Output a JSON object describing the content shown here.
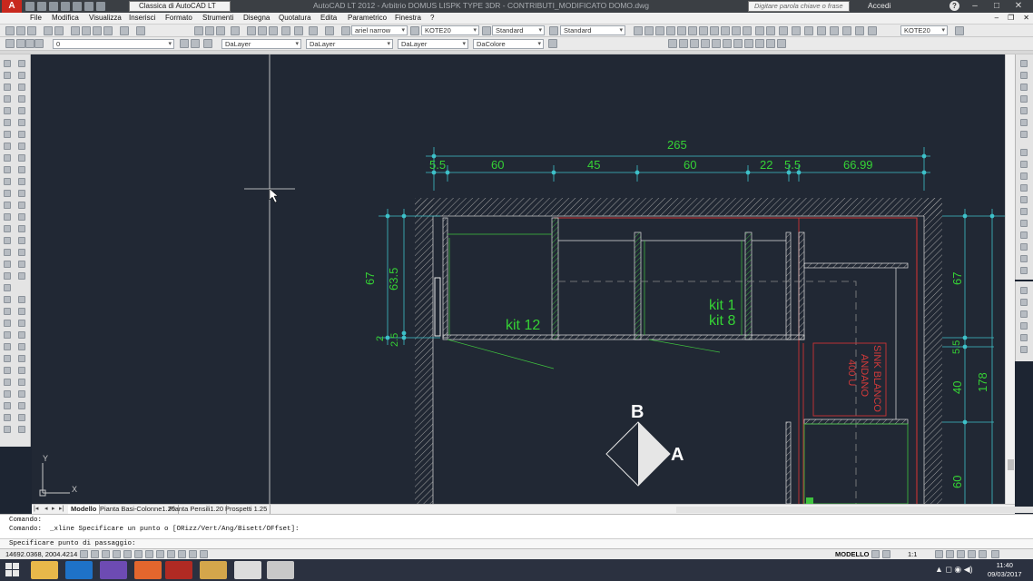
{
  "titlebar": {
    "workspace": "Classica di AutoCAD LT",
    "title": "AutoCAD LT 2012 - Arbitrio DOMUS LISPK TYPE 3DR - CONTRIBUTI_MODIFICATO DOMO.dwg",
    "search_placeholder": "Digitare parola chiave o frase",
    "login": "Accedi",
    "help": "?"
  },
  "menu": [
    "File",
    "Modifica",
    "Visualizza",
    "Inserisci",
    "Formato",
    "Strumenti",
    "Disegna",
    "Quotatura",
    "Edita",
    "Parametrico",
    "Finestra",
    "?"
  ],
  "toolbar": {
    "text_style": "ariel narrow",
    "dim_style": "KOTE20",
    "table_style": "Standard",
    "mleader_style": "Standard",
    "dim_style_right": "KOTE20",
    "layer_current": "0",
    "color": "DaLayer",
    "linetype": "DaLayer",
    "lineweight": "DaLayer",
    "plotstyle": "DaColore"
  },
  "drawing": {
    "dims_top": {
      "overall": "265",
      "segments": [
        "5.5",
        "60",
        "45",
        "60",
        "22",
        "5.5",
        "66.99"
      ]
    },
    "dims_left": [
      "67",
      "63.5",
      "2",
      "2.5"
    ],
    "dims_right": [
      "67",
      "5.5",
      "40",
      "178",
      "60"
    ],
    "labels": [
      "kit 12",
      "kit 1",
      "kit 8"
    ],
    "sink_text": [
      "SINK BLANCO",
      "ANDANO",
      "400 U"
    ],
    "compass": {
      "top": "B",
      "right": "A"
    },
    "ucs": {
      "y": "Y",
      "x": "X"
    }
  },
  "tabs": [
    "Modello",
    "Pianta Basi-Colonne1.20",
    "Pianta Pensili1.20",
    "Prospetti 1.25"
  ],
  "command": {
    "line1": "Comando:",
    "line2": "Comando:  _xline Specificare un punto o [ORizz/Vert/Ang/Bisett/OFfset]:",
    "prompt": "Specificare punto di passaggio:"
  },
  "status": {
    "coords": "14692.0368, 2004.4214",
    "mode": "MODELLO",
    "annotation_scale": "1:1"
  },
  "taskbar": {
    "time": "11:40",
    "date": "09/03/2017"
  },
  "colors": {
    "canvas": "#212834",
    "dimension": "#3ec1c9",
    "text_green": "#35d235",
    "wall": "#cc3333",
    "cabinet": "#e8e8e8"
  }
}
